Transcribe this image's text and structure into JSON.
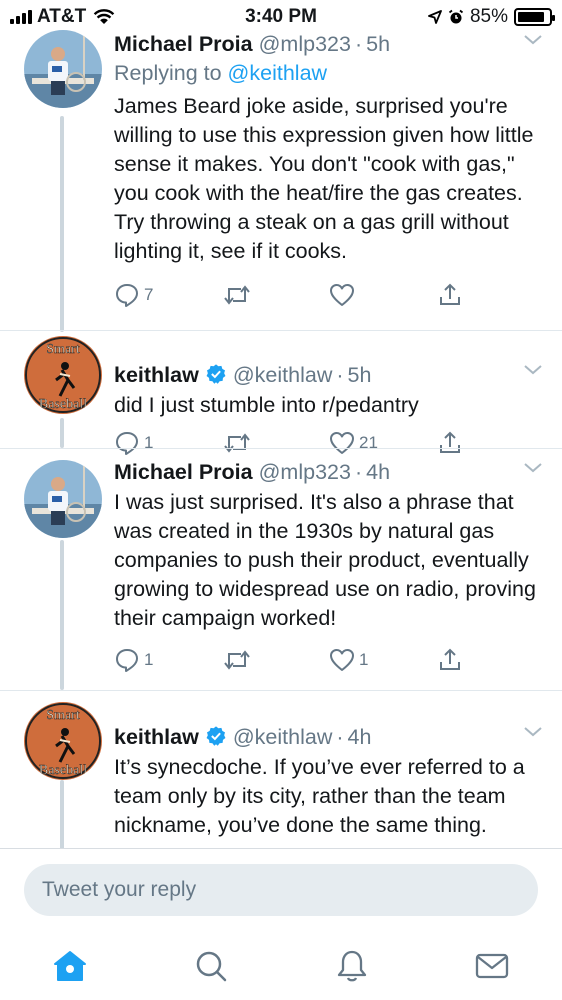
{
  "status_bar": {
    "carrier": "AT&T",
    "time": "3:40 PM",
    "battery_percent": "85%",
    "battery_level": 0.85
  },
  "tweets": [
    {
      "name": "Michael Proia",
      "handle": "@mlp323",
      "time": "5h",
      "verified": false,
      "replying_prefix": "Replying to ",
      "replying_to": "@keithlaw",
      "text": "James Beard joke aside, surprised you're willing to use this expression given how little sense it makes. You don't \"cook with gas,\" you cook with the heat/fire the gas creates. Try throwing a steak on a gas grill without lighting it, see if it cooks.",
      "replies": "7",
      "retweets": "",
      "likes": ""
    },
    {
      "name": "keithlaw",
      "handle": "@keithlaw",
      "time": "5h",
      "verified": true,
      "text": "did I just stumble into r/pedantry",
      "replies": "1",
      "retweets": "",
      "likes": "21"
    },
    {
      "name": "Michael Proia",
      "handle": "@mlp323",
      "time": "4h",
      "verified": false,
      "text": "I was just surprised.  It's also a phrase that was created in the 1930s by natural gas companies to push their product, eventually growing to widespread use on radio, proving their campaign worked!",
      "replies": "1",
      "retweets": "",
      "likes": "1"
    },
    {
      "name": "keithlaw",
      "handle": "@keithlaw",
      "time": "4h",
      "verified": true,
      "text": "It’s synecdoche. If you’ve ever referred to a team only by its city, rather than the team nickname, you’ve done the same thing."
    }
  ],
  "avatar_logo": {
    "top": "Smart",
    "bottom": "Baseball"
  },
  "reply_bar": {
    "placeholder": "Tweet your reply"
  },
  "tab_bar": {
    "items": [
      "home-icon",
      "search-icon",
      "notifications-icon",
      "messages-icon"
    ],
    "active": "home-icon"
  },
  "colors": {
    "accent": "#1da1f2",
    "secondary_text": "#657786",
    "thread_line": "#ccd6dd",
    "reply_field": "#e6ecf0"
  }
}
